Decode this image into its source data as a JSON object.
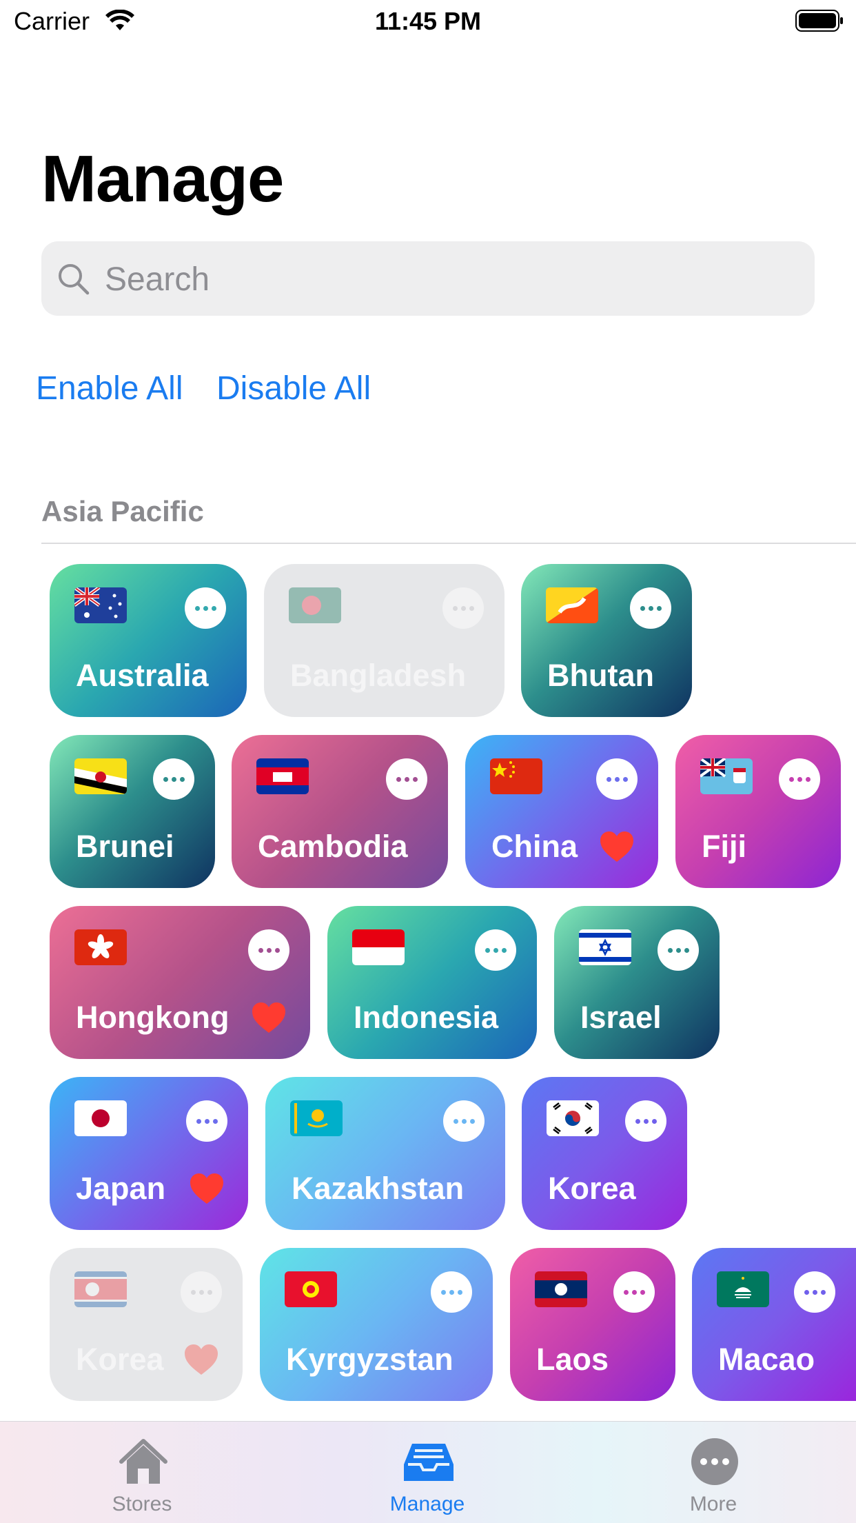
{
  "status_bar": {
    "carrier": "Carrier",
    "time": "11:45 PM"
  },
  "page": {
    "title": "Manage"
  },
  "search": {
    "placeholder": "Search"
  },
  "actions": {
    "enable_all": "Enable All",
    "disable_all": "Disable All"
  },
  "section": {
    "title": "Asia Pacific"
  },
  "stores": [
    {
      "name": "Australia",
      "enabled": true,
      "favorite": false
    },
    {
      "name": "Bangladesh",
      "enabled": false,
      "favorite": false
    },
    {
      "name": "Bhutan",
      "enabled": true,
      "favorite": false
    },
    {
      "name": "Brunei",
      "enabled": true,
      "favorite": false
    },
    {
      "name": "Cambodia",
      "enabled": true,
      "favorite": false
    },
    {
      "name": "China",
      "enabled": true,
      "favorite": true
    },
    {
      "name": "Fiji",
      "enabled": true,
      "favorite": false
    },
    {
      "name": "Hongkong",
      "enabled": true,
      "favorite": true
    },
    {
      "name": "Indonesia",
      "enabled": true,
      "favorite": false
    },
    {
      "name": "Israel",
      "enabled": true,
      "favorite": false
    },
    {
      "name": "Japan",
      "enabled": true,
      "favorite": true
    },
    {
      "name": "Kazakhstan",
      "enabled": true,
      "favorite": false
    },
    {
      "name": "Korea",
      "enabled": true,
      "favorite": false
    },
    {
      "name": "Korea",
      "enabled": false,
      "favorite": true
    },
    {
      "name": "Kyrgyzstan",
      "enabled": true,
      "favorite": false
    },
    {
      "name": "Laos",
      "enabled": true,
      "favorite": false
    },
    {
      "name": "Macao",
      "enabled": true,
      "favorite": false
    }
  ],
  "tab_bar": {
    "stores_label": "Stores",
    "manage_label": "Manage",
    "more_label": "More",
    "active": "Manage"
  },
  "colors": {
    "accent": "#1a7cf0",
    "heart": "#ff3b30",
    "inactive_tab": "#8e8e93"
  }
}
